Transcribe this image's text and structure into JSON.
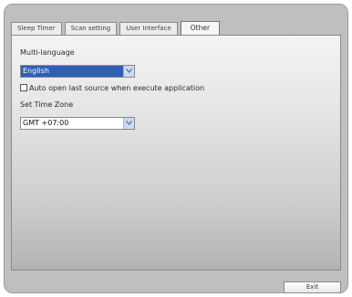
{
  "tabs": [
    {
      "label": "Sleep Timer",
      "active": false
    },
    {
      "label": "Scan setting",
      "active": false
    },
    {
      "label": "User Interface",
      "active": false
    },
    {
      "label": "Other",
      "active": true
    }
  ],
  "language": {
    "label": "Multi-language",
    "selected": "English"
  },
  "auto_open": {
    "label": "Auto open last source when execute application",
    "checked": false
  },
  "timezone": {
    "label": "Set Time Zone",
    "selected": "GMT +07:00"
  },
  "exit_label": "Exit",
  "colors": {
    "selection": "#2f5fb4",
    "frame": "#bfbfbf",
    "arrow_button": "#c9daf3"
  },
  "icons": [
    "chevron-down-icon",
    "checkbox-unchecked"
  ]
}
